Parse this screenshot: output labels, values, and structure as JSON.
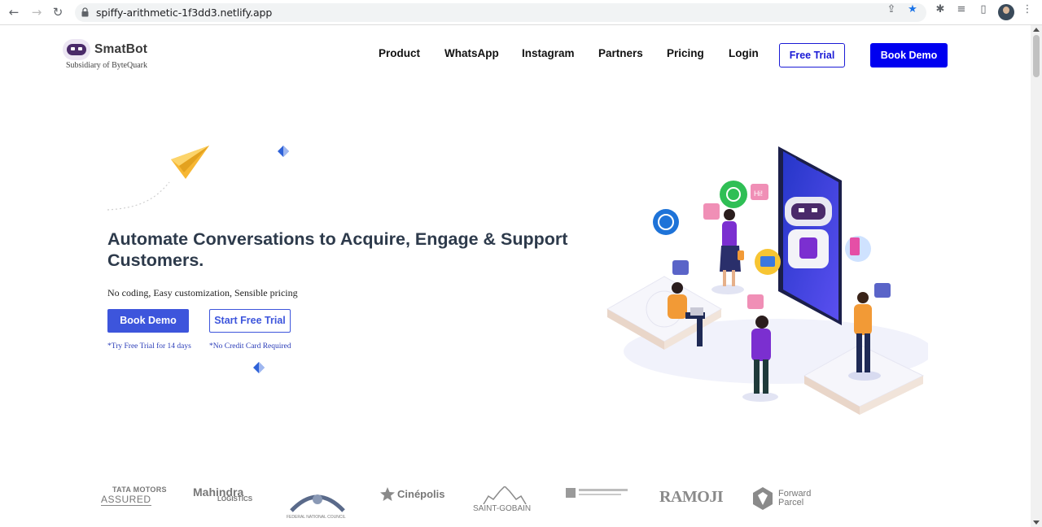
{
  "browser": {
    "url": "spiffy-arithmetic-1f3dd3.netlify.app",
    "back_icon": "back-arrow-icon",
    "forward_icon": "forward-arrow-icon",
    "reload_icon": "reload-icon"
  },
  "header": {
    "logo_name": "SmatBot",
    "logo_subtitle": "Subsidiary of ByteQuark",
    "nav": [
      "Product",
      "WhatsApp",
      "Instagram",
      "Partners",
      "Pricing",
      "Login"
    ],
    "free_trial_label": "Free Trial",
    "book_demo_label": "Book Demo"
  },
  "hero": {
    "title": "Automate Conversations to Acquire, Engage & Support Customers.",
    "subtitle": "No coding, Easy customization, Sensible pricing",
    "book_demo_label": "Book Demo",
    "start_trial_label": "Start Free Trial",
    "note_trial": "*Try Free Trial for 14 days",
    "note_card": "*No Credit Card Required",
    "illustration_bubble": "Hi!"
  },
  "brands": {
    "tata_line1": "TATA MOTORS",
    "tata_line2": "ASSURED",
    "mahindra_line1": "Mahindra",
    "mahindra_line2": "LOGISTICS",
    "fnc": "FEDERAL NATIONAL COUNCIL",
    "cinepolis": "Cinépolis",
    "saint_gobain": "SAINT-GOBAIN",
    "ramoji": "RAMOJI",
    "forward_parcel_line1": "Forward",
    "forward_parcel_line2": "Parcel"
  },
  "colors": {
    "primary_blue": "#0000f0",
    "hero_button": "#3d55dc",
    "title_text": "#2d3a4b",
    "purple": "#7b2fd0"
  }
}
